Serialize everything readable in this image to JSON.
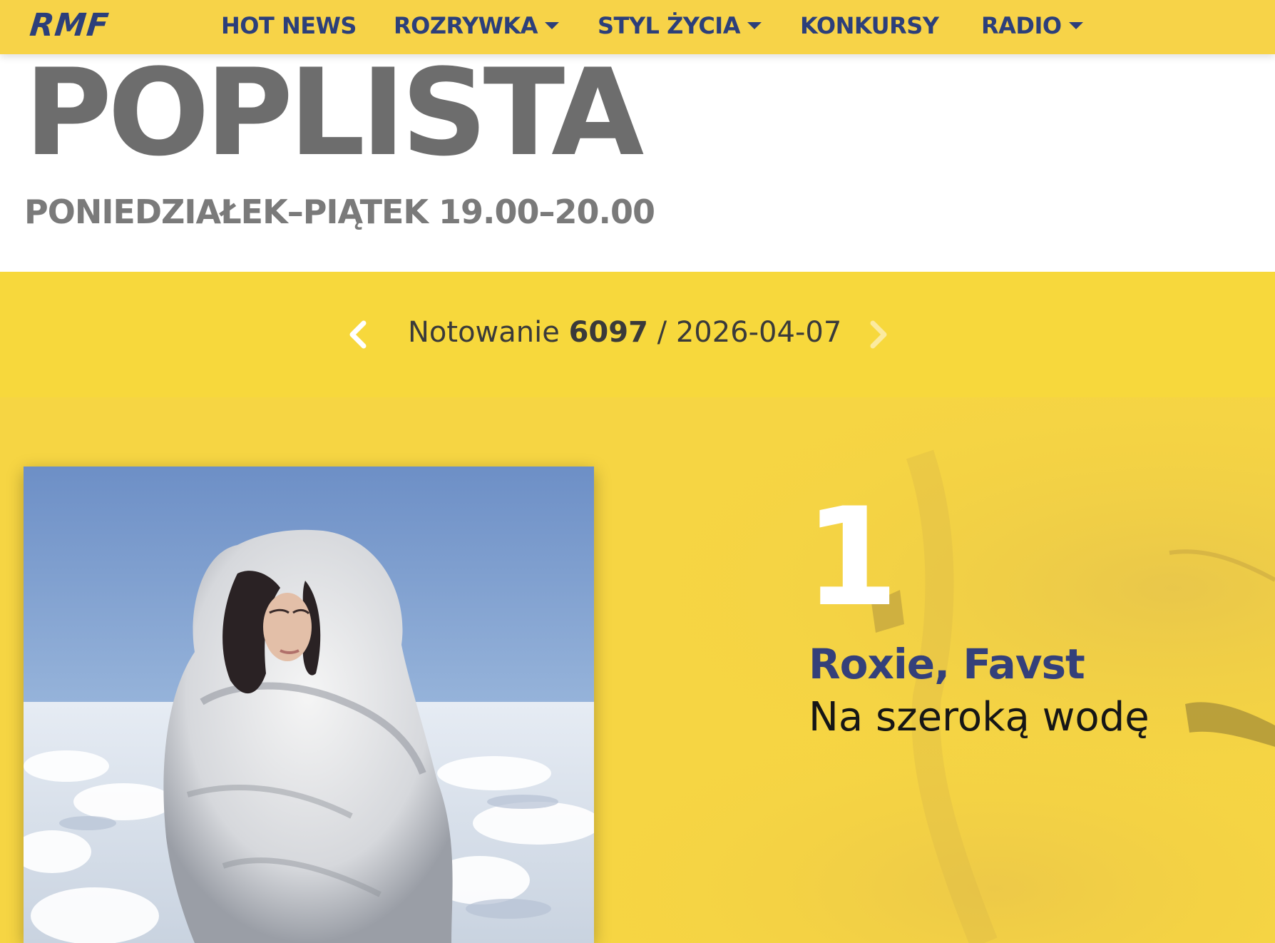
{
  "nav": {
    "logo": "RMF",
    "items": [
      {
        "label": "HOT NEWS",
        "has_dropdown": false
      },
      {
        "label": "ROZRYWKA",
        "has_dropdown": true
      },
      {
        "label": "STYL ŻYCIA",
        "has_dropdown": true
      },
      {
        "label": "KONKURSY",
        "has_dropdown": false
      },
      {
        "label": "RADIO",
        "has_dropdown": true
      }
    ]
  },
  "header": {
    "title": "POPLISTA",
    "schedule": "PONIEDZIAŁEK–PIĄTEK 19.00–20.00"
  },
  "edition": {
    "label": "Notowanie",
    "number": "6097",
    "separator": "/",
    "date": "2026-04-07"
  },
  "entry": {
    "rank": "1",
    "artist": "Roxie, Favst",
    "title": "Na szeroką wodę"
  },
  "colors": {
    "nav_bg": "#f7d348",
    "brand_blue": "#2c3f7a",
    "yellow": "#f7d83c"
  }
}
